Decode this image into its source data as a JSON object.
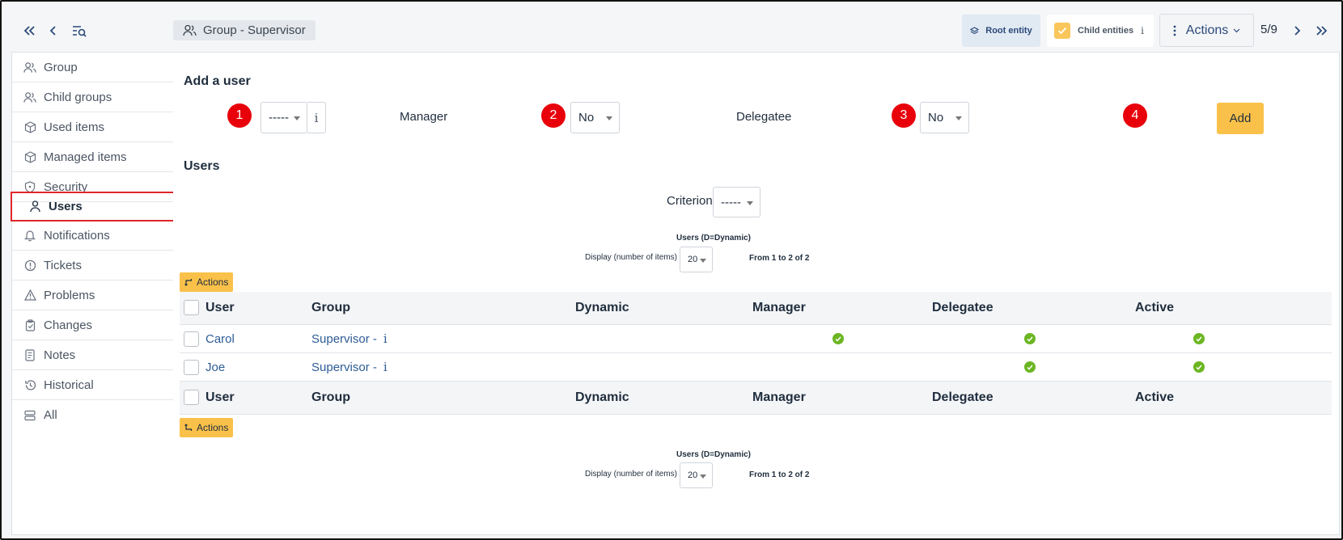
{
  "breadcrumb": {
    "label": "Group -  Supervisor"
  },
  "header": {
    "root_entity": "Root entity",
    "child_entities": "Child entities",
    "child_entities_info": "i",
    "actions": "Actions",
    "counter": "5/9"
  },
  "sidebar": {
    "items": [
      {
        "label": "Group",
        "icon": "users-icon"
      },
      {
        "label": "Child groups",
        "icon": "users-icon"
      },
      {
        "label": "Used items",
        "icon": "box-icon"
      },
      {
        "label": "Managed items",
        "icon": "box-icon"
      },
      {
        "label": "Security",
        "icon": "shield-icon"
      },
      {
        "label": "Users",
        "icon": "user-icon",
        "active": true
      },
      {
        "label": "Notifications",
        "icon": "bell-icon"
      },
      {
        "label": "Tickets",
        "icon": "alert-circle-icon"
      },
      {
        "label": "Problems",
        "icon": "warning-triangle-icon"
      },
      {
        "label": "Changes",
        "icon": "clipboard-check-icon"
      },
      {
        "label": "Notes",
        "icon": "notes-icon"
      },
      {
        "label": "Historical",
        "icon": "history-icon"
      },
      {
        "label": "All",
        "icon": "stack-icon"
      }
    ]
  },
  "add_user": {
    "title": "Add a user",
    "user_select": "-----",
    "info": "i",
    "manager_label": "Manager",
    "manager_value": "No",
    "delegatee_label": "Delegatee",
    "delegatee_value": "No",
    "add_button": "Add",
    "badges": [
      "1",
      "2",
      "3",
      "4"
    ]
  },
  "users": {
    "title": "Users",
    "criterion_label": "Criterion",
    "criterion_value": "-----",
    "caption": "Users (D=Dynamic)",
    "display_label": "Display (number of items)",
    "display_value": "20",
    "range": "From 1 to 2 of 2",
    "actions_label": "Actions",
    "columns": [
      "User",
      "Group",
      "Dynamic",
      "Manager",
      "Delegatee",
      "Active"
    ],
    "rows": [
      {
        "user": "Carol",
        "group": "Supervisor - ",
        "info": "i",
        "dynamic": false,
        "manager": true,
        "delegatee": true,
        "active": true
      },
      {
        "user": "Joe",
        "group": "Supervisor - ",
        "info": "i",
        "dynamic": false,
        "manager": false,
        "delegatee": true,
        "active": true
      }
    ]
  },
  "colors": {
    "accent": "#fac14a",
    "badge": "#e8000b",
    "link": "#2d5c96",
    "check": "#6cb623"
  }
}
